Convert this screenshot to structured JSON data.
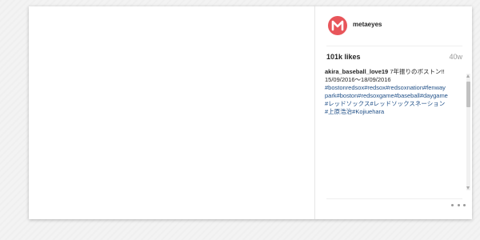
{
  "post": {
    "username": "metaeyes",
    "likes": "101k likes",
    "timestamp": "40w",
    "caption": {
      "user": "akira_baseball_love19",
      "text": "7年振りのボストン!!",
      "dates": "15/09/2016〜18/09/2016",
      "hashtag_lines": [
        "#bostonredsox#redsox#redsoxnation#fenway",
        "park#boston#redsoxgame#baseball#daygame",
        "#レッドソックス#レッドソックスネーション",
        "#上原浩治#Kojiuehara"
      ]
    }
  },
  "colors": {
    "avatar_bg": "#e8555a",
    "hashtag": "#1f4f87",
    "text": "#262626",
    "muted": "#999999"
  },
  "icons": {
    "avatar": "letter-m-avatar-icon",
    "more": "ellipsis-icon"
  }
}
